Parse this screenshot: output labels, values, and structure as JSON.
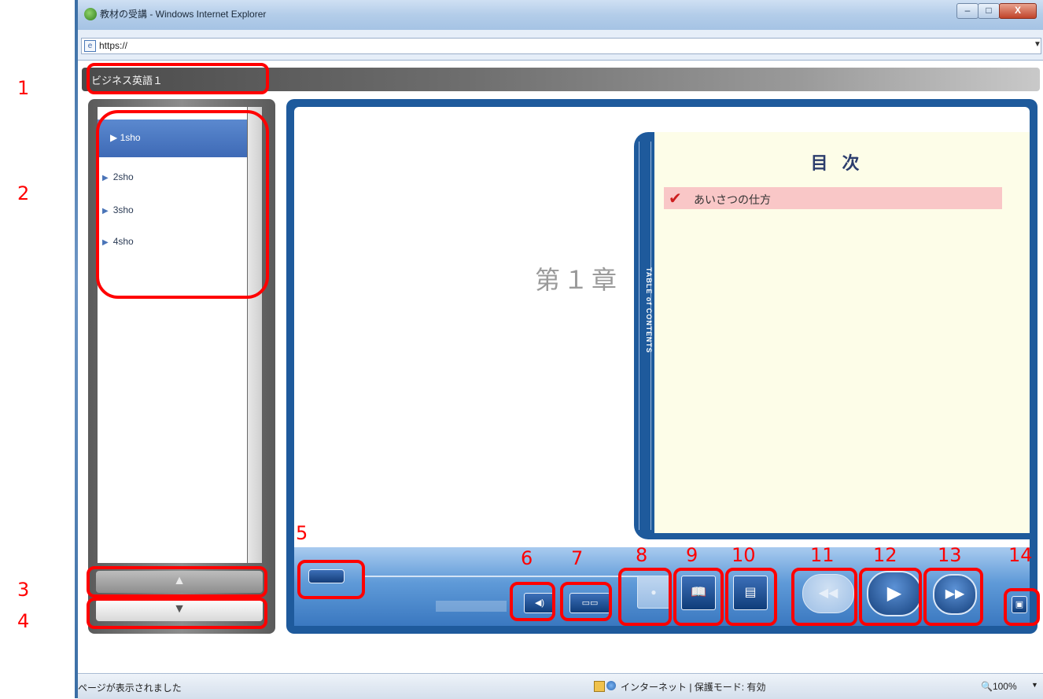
{
  "window": {
    "title": "教材の受講 - Windows Internet Explorer",
    "controls": {
      "minimize": "–",
      "maximize": "□",
      "close": "X"
    }
  },
  "address": {
    "url": "https://",
    "icon": "e",
    "dropdown": "▼"
  },
  "app": {
    "title": "ビジネス英語１"
  },
  "sidebar": {
    "items": [
      {
        "label": "1sho",
        "active": true
      },
      {
        "label": "2sho",
        "active": false
      },
      {
        "label": "3sho",
        "active": false
      },
      {
        "label": "4sho",
        "active": false
      }
    ],
    "bullet": "▶",
    "scroll_up": "▲",
    "scroll_down": "▼"
  },
  "stage": {
    "chapter": "第１章"
  },
  "toc": {
    "spine_label": "TABLE of CONTENTS",
    "heading": "目次",
    "items": [
      {
        "label": "あいさつの仕方",
        "checked": true
      }
    ],
    "check_glyph": "✔"
  },
  "controls": {
    "seek_icon": "seek-handle",
    "mute_glyph": "◀)",
    "subtitle_glyph": "▭▭",
    "bookmark_glyph": "●",
    "book_glyph": "📖",
    "page_glyph": "▤",
    "prev_glyph": "◀◀",
    "play_glyph": "▶",
    "next_glyph": "▶▶",
    "fullscreen_glyph": "▣"
  },
  "status": {
    "left": "ページが表示されました",
    "zone": "インターネット | 保護モード: 有効",
    "zoom": "100%",
    "zoom_arrow": "▼"
  },
  "annotations": {
    "labels": [
      "1",
      "2",
      "3",
      "4",
      "5",
      "6",
      "7",
      "8",
      "9",
      "10",
      "11",
      "12",
      "13",
      "14"
    ],
    "color": "#ff0000"
  }
}
